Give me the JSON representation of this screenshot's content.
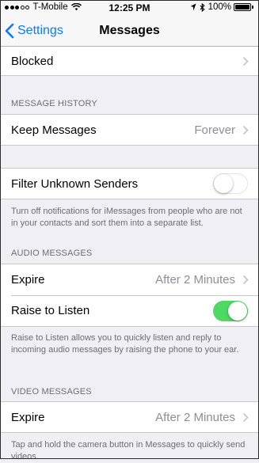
{
  "status_bar": {
    "carrier": "T-Mobile",
    "time": "12:25 PM",
    "battery": "100%",
    "icons": [
      "signal-dots",
      "wifi-icon",
      "location-arrow-icon",
      "bluetooth-icon",
      "battery-icon"
    ]
  },
  "nav": {
    "back_label": "Settings",
    "title": "Messages"
  },
  "blocked": {
    "label": "Blocked"
  },
  "message_history": {
    "header": "MESSAGE HISTORY",
    "keep_messages": {
      "label": "Keep Messages",
      "value": "Forever"
    }
  },
  "filter": {
    "label": "Filter Unknown Senders",
    "enabled": false,
    "footer": "Turn off notifications for iMessages from people who are not in your contacts and sort them into a separate list."
  },
  "audio_messages": {
    "header": "AUDIO MESSAGES",
    "expire": {
      "label": "Expire",
      "value": "After 2 Minutes"
    },
    "raise_to_listen": {
      "label": "Raise to Listen",
      "enabled": true
    },
    "footer": "Raise to Listen allows you to quickly listen and reply to incoming audio messages by raising the phone to your ear."
  },
  "video_messages": {
    "header": "VIDEO MESSAGES",
    "expire": {
      "label": "Expire",
      "value": "After 2 Minutes"
    },
    "footer": "Tap and hold the camera button in Messages to quickly send videos."
  },
  "colors": {
    "accent": "#0a7aff",
    "toggle_on": "#4cd964",
    "background": "#efeff4",
    "secondary_text": "#8e8e93"
  }
}
